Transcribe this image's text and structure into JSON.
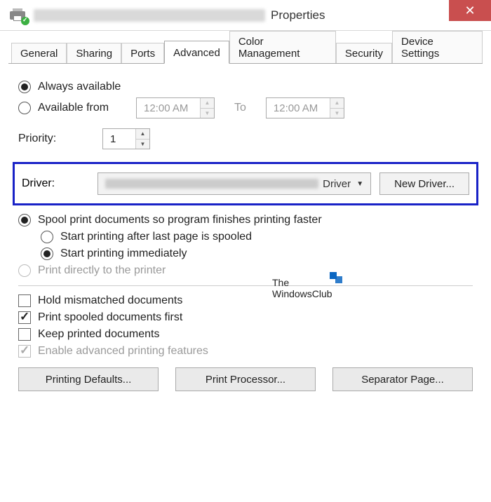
{
  "titlebar": {
    "title_suffix": "Properties",
    "close": "✕"
  },
  "tabs": {
    "general": "General",
    "sharing": "Sharing",
    "ports": "Ports",
    "advanced": "Advanced",
    "color": "Color Management",
    "security": "Security",
    "device": "Device Settings"
  },
  "availability": {
    "always": "Always available",
    "from_label": "Available from",
    "from_value": "12:00 AM",
    "to_label": "To",
    "to_value": "12:00 AM"
  },
  "priority": {
    "label": "Priority:",
    "value": "1"
  },
  "driver": {
    "label": "Driver:",
    "combo_suffix": "Driver",
    "new_button": "New Driver..."
  },
  "spool": {
    "spool_docs": "Spool print documents so program finishes printing faster",
    "start_after": "Start printing after last page is spooled",
    "start_immediate": "Start printing immediately",
    "print_direct": "Print directly to the printer"
  },
  "options": {
    "hold_mismatch": "Hold mismatched documents",
    "print_spooled_first": "Print spooled documents first",
    "keep_printed": "Keep printed documents",
    "enable_advanced": "Enable advanced printing features"
  },
  "buttons": {
    "defaults": "Printing Defaults...",
    "processor": "Print Processor...",
    "separator": "Separator Page..."
  },
  "watermark": {
    "line1": "The",
    "line2": "WindowsClub"
  }
}
